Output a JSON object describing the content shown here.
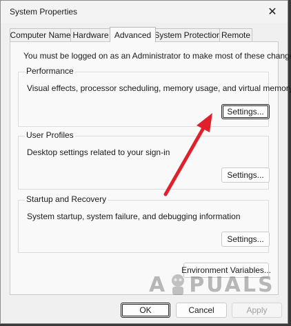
{
  "window": {
    "title": "System Properties",
    "close_glyph": "✕"
  },
  "tabs": [
    {
      "label": "Computer Name",
      "active": false
    },
    {
      "label": "Hardware",
      "active": false
    },
    {
      "label": "Advanced",
      "active": true
    },
    {
      "label": "System Protection",
      "active": false
    },
    {
      "label": "Remote",
      "active": false
    }
  ],
  "advanced": {
    "admin_note": "You must be logged on as an Administrator to make most of these changes.",
    "performance": {
      "title": "Performance",
      "description": "Visual effects, processor scheduling, memory usage, and virtual memory",
      "button": "Settings..."
    },
    "user_profiles": {
      "title": "User Profiles",
      "description": "Desktop settings related to your sign-in",
      "button": "Settings..."
    },
    "startup_recovery": {
      "title": "Startup and Recovery",
      "description": "System startup, system failure, and debugging information",
      "button": "Settings..."
    },
    "env_button": "Environment Variables..."
  },
  "footer": {
    "ok": "OK",
    "cancel": "Cancel",
    "apply": "Apply"
  },
  "annotation": {
    "arrow_color": "#e0202a"
  },
  "watermark": {
    "first_letter": "A",
    "rest": "PUALS"
  }
}
